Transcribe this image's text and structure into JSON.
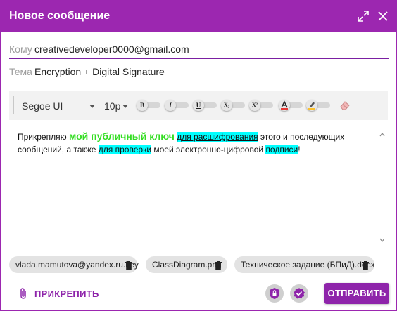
{
  "window": {
    "title": "Новое сообщение"
  },
  "fields": {
    "to": {
      "label": "Кому",
      "value": "creativedeveloper0000@gmail.com"
    },
    "subject": {
      "label": "Тема",
      "value": "Encryption + Digital Signature"
    }
  },
  "toolbar": {
    "font": "Segoe UI",
    "size": "10p",
    "buttons": [
      {
        "name": "bold",
        "glyph": "B"
      },
      {
        "name": "italic",
        "glyph": "I"
      },
      {
        "name": "underline",
        "glyph": "U"
      },
      {
        "name": "subscript",
        "glyph": "X₂"
      },
      {
        "name": "superscript",
        "glyph": "X²"
      }
    ]
  },
  "body": {
    "p1": "Прикрепляю ",
    "p2": "мой публичный ключ",
    "p3": " ",
    "p4": "для расшифрования",
    "p5": " этого и последующих сообщений, а также ",
    "p6": "для проверки",
    "p7": " моей электронно-цифровой ",
    "p8": "подписи",
    "p9": "!"
  },
  "attachments": [
    {
      "name": "vlada.mamutova@yandex.ru.key"
    },
    {
      "name": "ClassDiagram.png"
    },
    {
      "name": "Техническое задание (БПиД).docx"
    }
  ],
  "footer": {
    "attach_label": "ПРИКРЕПИТЬ",
    "send_label": "ОТПРАВИТЬ"
  },
  "colors": {
    "accent": "#9c27b0",
    "highlight": "#00ffff",
    "key_text": "#33dd22"
  },
  "icons": [
    "expand-icon",
    "close-icon",
    "font-color-icon",
    "highlight-color-icon",
    "eraser-icon",
    "paperclip-icon",
    "encrypt-shield-icon",
    "sign-check-icon",
    "trash-icon"
  ]
}
